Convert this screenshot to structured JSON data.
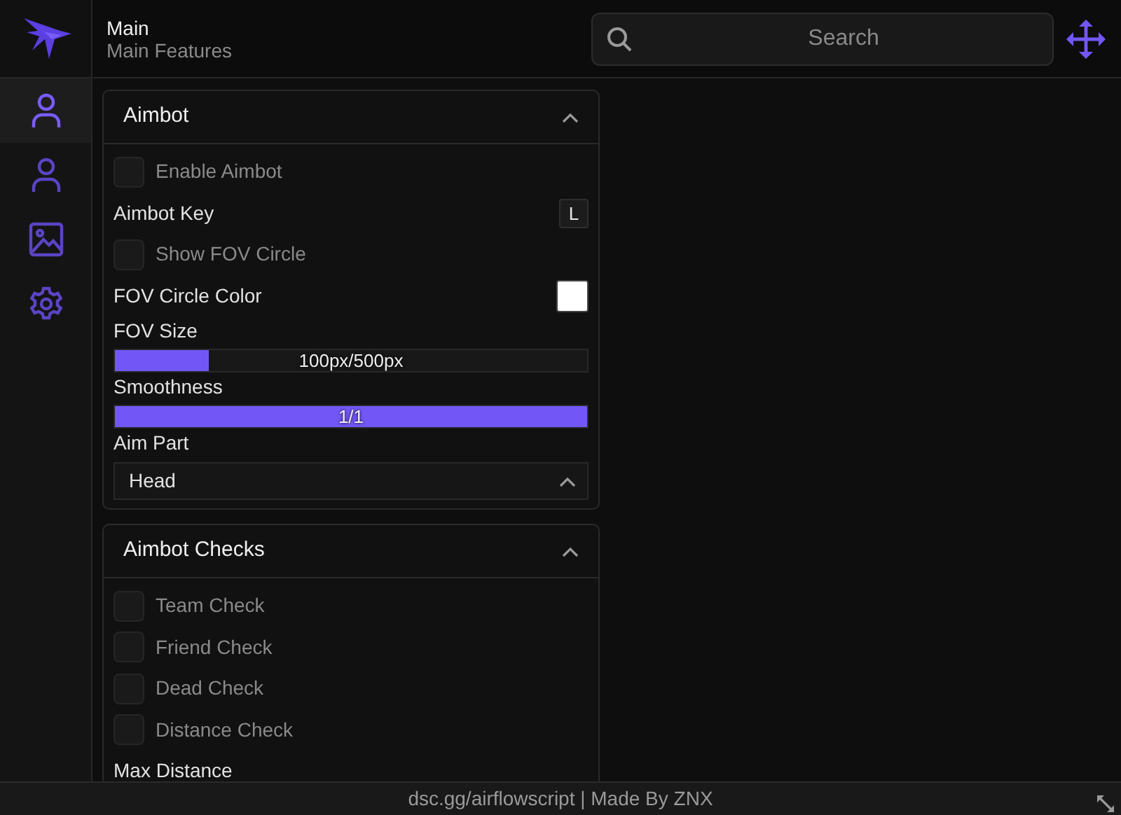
{
  "header": {
    "title": "Main",
    "subtitle": "Main Features",
    "search": {
      "placeholder": "Search"
    }
  },
  "sidebar": {
    "items": [
      {
        "kind": "person",
        "selected": true
      },
      {
        "kind": "person",
        "selected": false
      },
      {
        "kind": "image",
        "selected": false
      },
      {
        "kind": "gear",
        "selected": false
      }
    ]
  },
  "sections": [
    {
      "title": "Aimbot",
      "expanded": true,
      "items": [
        {
          "kind": "checkbox",
          "label": "Enable Aimbot",
          "checked": false
        },
        {
          "kind": "keybind",
          "label": "Aimbot Key",
          "value": "L"
        },
        {
          "kind": "checkbox",
          "label": "Show FOV Circle",
          "checked": false
        },
        {
          "kind": "color",
          "label": "FOV Circle Color",
          "color": "#ffffff"
        },
        {
          "kind": "slider",
          "label": "FOV Size",
          "level": 0.2,
          "reading": "100px/500px"
        },
        {
          "kind": "slider",
          "label": "Smoothness",
          "level": 1,
          "reading": "1/1"
        },
        {
          "kind": "dropdown",
          "label": "Aim Part",
          "value": "Head",
          "expanded": true
        }
      ]
    },
    {
      "title": "Aimbot Checks",
      "expanded": true,
      "items": [
        {
          "kind": "checkbox",
          "label": "Team Check",
          "checked": false
        },
        {
          "kind": "checkbox",
          "label": "Friend Check",
          "checked": false
        },
        {
          "kind": "checkbox",
          "label": "Dead Check",
          "checked": false
        },
        {
          "kind": "checkbox",
          "label": "Distance Check",
          "checked": false
        },
        {
          "kind": "label",
          "label": "Max Distance"
        }
      ]
    }
  ],
  "status_bar": "dsc.gg/airflowscript | Made By ZNX"
}
